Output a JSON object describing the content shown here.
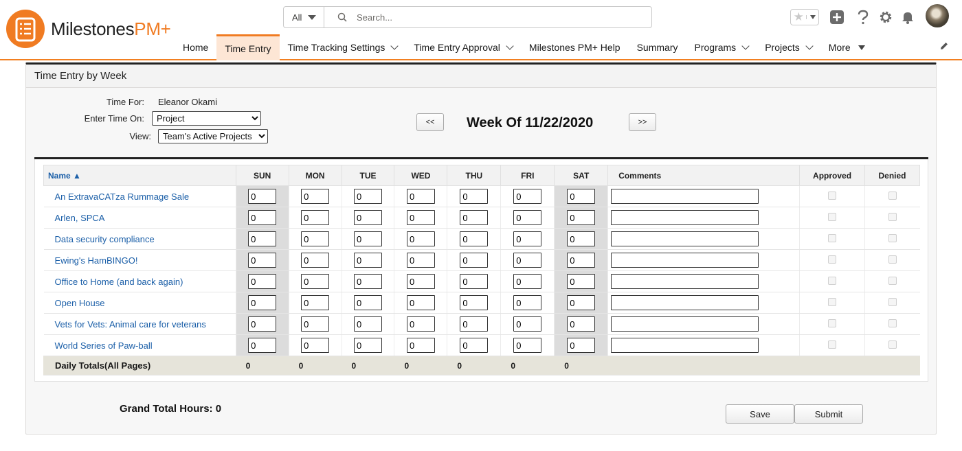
{
  "app": {
    "name_main": "Milestones",
    "name_accent": "PM+"
  },
  "search": {
    "scope": "All",
    "placeholder": "Search..."
  },
  "nav": [
    {
      "label": "Home",
      "menu": false
    },
    {
      "label": "Time Entry",
      "menu": false,
      "active": true
    },
    {
      "label": "Time Tracking Settings",
      "menu": true
    },
    {
      "label": "Time Entry Approval",
      "menu": true
    },
    {
      "label": "Milestones PM+ Help",
      "menu": false
    },
    {
      "label": "Summary",
      "menu": false
    },
    {
      "label": "Programs",
      "menu": true
    },
    {
      "label": "Projects",
      "menu": true
    },
    {
      "label": "More",
      "menu": "triangle"
    }
  ],
  "panel": {
    "title": "Time Entry by Week",
    "time_for_label": "Time For:",
    "time_for_value": "Eleanor Okami",
    "enter_time_label": "Enter Time On:",
    "enter_time_value": "Project",
    "view_label": "View:",
    "view_value": "Team's Active Projects",
    "prev_label": "<<",
    "next_label": ">>",
    "week_title": "Week Of 11/22/2020"
  },
  "grid": {
    "name_header": "Name ▲",
    "days": [
      "SUN",
      "MON",
      "TUE",
      "WED",
      "THU",
      "FRI",
      "SAT"
    ],
    "comments_header": "Comments",
    "approved_header": "Approved",
    "denied_header": "Denied",
    "rows": [
      {
        "name": "An ExtravaCATza Rummage Sale",
        "hours": [
          "0",
          "0",
          "0",
          "0",
          "0",
          "0",
          "0"
        ]
      },
      {
        "name": "Arlen, SPCA",
        "hours": [
          "0",
          "0",
          "0",
          "0",
          "0",
          "0",
          "0"
        ]
      },
      {
        "name": "Data security compliance",
        "hours": [
          "0",
          "0",
          "0",
          "0",
          "0",
          "0",
          "0"
        ]
      },
      {
        "name": "Ewing's HamBINGO!",
        "hours": [
          "0",
          "0",
          "0",
          "0",
          "0",
          "0",
          "0"
        ]
      },
      {
        "name": "Office to Home (and back again)",
        "hours": [
          "0",
          "0",
          "0",
          "0",
          "0",
          "0",
          "0"
        ]
      },
      {
        "name": "Open House",
        "hours": [
          "0",
          "0",
          "0",
          "0",
          "0",
          "0",
          "0"
        ]
      },
      {
        "name": "Vets for Vets: Animal care for veterans",
        "hours": [
          "0",
          "0",
          "0",
          "0",
          "0",
          "0",
          "0"
        ]
      },
      {
        "name": "World Series of Paw-ball",
        "hours": [
          "0",
          "0",
          "0",
          "0",
          "0",
          "0",
          "0"
        ]
      }
    ],
    "totals_label": "Daily Totals(All Pages)",
    "totals": [
      "0",
      "0",
      "0",
      "0",
      "0",
      "0",
      "0"
    ]
  },
  "footer": {
    "grand_total": "Grand Total Hours: 0",
    "save_label": "Save",
    "submit_label": "Submit"
  },
  "colors": {
    "brand": "#f07b22",
    "link": "#1b5fa8",
    "active_tab": "#fde6d5"
  }
}
